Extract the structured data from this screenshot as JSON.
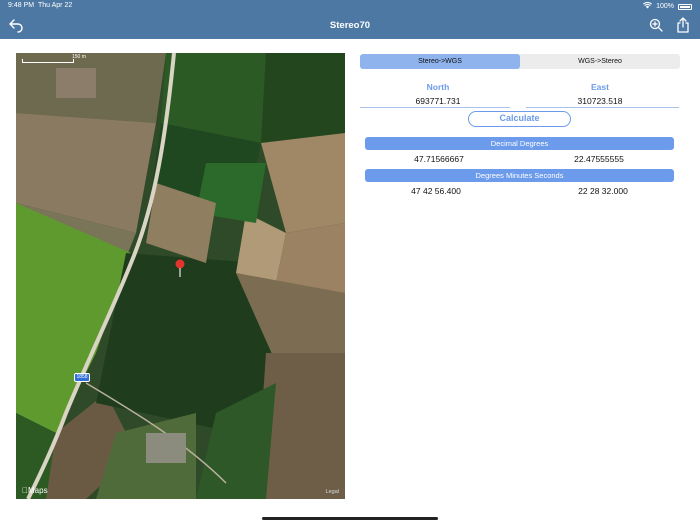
{
  "status": {
    "time": "9:48 PM",
    "date": "Thu Apr 22",
    "battery": "100%"
  },
  "nav": {
    "title": "Stereo70",
    "back_icon": "back-arrow-icon",
    "zoom_icon": "zoom-icon",
    "share_icon": "share-icon"
  },
  "map": {
    "label": "Maps",
    "legal": "Legal",
    "scale_label": "150 m",
    "road_sign": "1858"
  },
  "segment": {
    "options": [
      "Stereo->WGS",
      "WGS->Stereo"
    ],
    "selected": "Stereo->WGS"
  },
  "input": {
    "north_label": "North",
    "east_label": "East",
    "north_value": "693771.731",
    "east_value": "310723.518"
  },
  "calculate_label": "Calculate",
  "decimal": {
    "header": "Decimal Degrees",
    "lat": "47.71566667",
    "lon": "22.47555555"
  },
  "dms": {
    "header": "Degrees Minutes Seconds",
    "lat": "47 42 56.400",
    "lon": "22 28 32.000"
  },
  "colors": {
    "bar": "#4d78a4",
    "accent": "#6b9bea",
    "segment_active": "#8fb3ec"
  }
}
